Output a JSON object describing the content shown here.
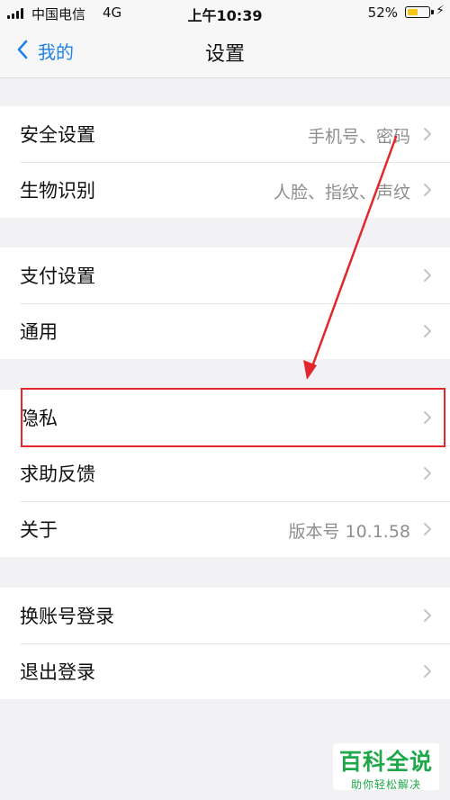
{
  "status_bar": {
    "carrier": "中国电信",
    "network": "4G",
    "time": "上午10:39",
    "battery_percent": "52%",
    "battery_level": 0.52,
    "charging_icon": "bolt-icon"
  },
  "nav": {
    "back_label": "我的",
    "title": "设置"
  },
  "groups": [
    {
      "items": [
        {
          "label": "安全设置",
          "value": "手机号、密码"
        },
        {
          "label": "生物识别",
          "value": "人脸、指纹、声纹"
        }
      ]
    },
    {
      "items": [
        {
          "label": "支付设置",
          "value": ""
        },
        {
          "label": "通用",
          "value": ""
        }
      ]
    },
    {
      "items": [
        {
          "label": "隐私",
          "value": ""
        },
        {
          "label": "求助反馈",
          "value": ""
        },
        {
          "label": "关于",
          "value": "版本号 10.1.58"
        }
      ]
    },
    {
      "items": [
        {
          "label": "换账号登录",
          "value": ""
        },
        {
          "label": "退出登录",
          "value": ""
        }
      ]
    }
  ],
  "watermark": {
    "main": "百科全说",
    "sub": "助你轻松解决"
  },
  "colors": {
    "accent": "#1f80e8",
    "annotation": "#e3262e",
    "watermark": "#1ea84a"
  }
}
